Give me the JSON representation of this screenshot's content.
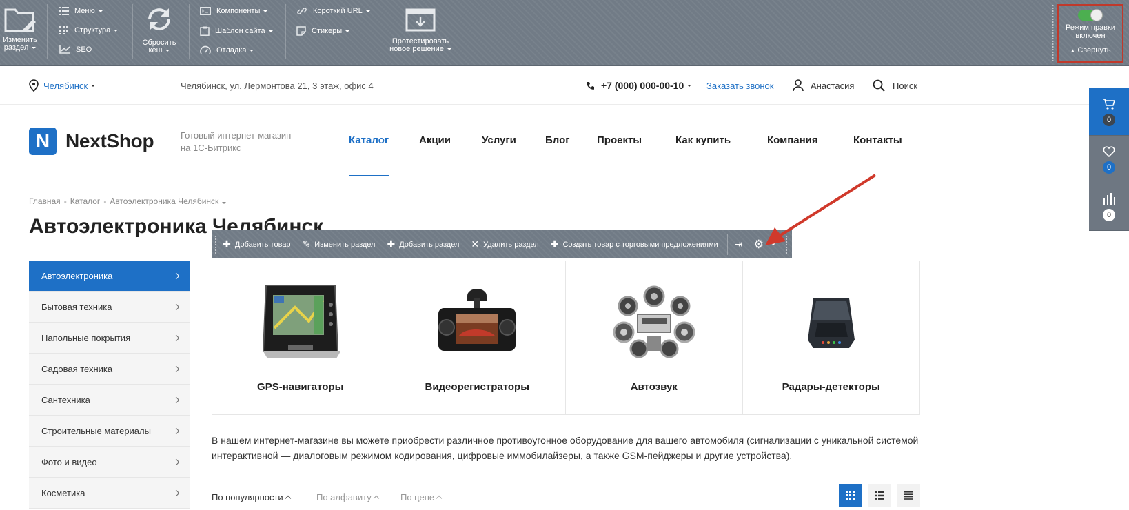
{
  "admin_panel": {
    "change_section": "Изменить раздел",
    "change_section_l1": "Изменить",
    "change_section_l2": "раздел",
    "menu": "Меню",
    "structure": "Структура",
    "seo": "SEO",
    "reset_cache_l1": "Сбросить",
    "reset_cache_l2": "кеш",
    "components": "Компоненты",
    "site_template": "Шаблон сайта",
    "debug": "Отладка",
    "short_url": "Короткий URL",
    "stickers": "Стикеры",
    "test_solution_l1": "Протестировать",
    "test_solution_l2": "новое решение",
    "edit_mode_l1": "Режим правки",
    "edit_mode_l2": "включен",
    "edit_mode_enabled": true,
    "collapse": "Свернуть"
  },
  "topline": {
    "city": "Челябинск",
    "address": "Челябинск, ул. Лермонтова 21, 3 этаж, офис 4",
    "phone": "+7 (000) 000-00-10",
    "callback": "Заказать звонок",
    "user": "Анастасия",
    "search": "Поиск"
  },
  "header": {
    "logo_text": "NextShop",
    "logo_mark": "N",
    "slogan_l1": "Готовый интернет-магазин",
    "slogan_l2": "на 1С-Битрикс",
    "nav": [
      "Каталог",
      "Акции",
      "Услуги",
      "Блог",
      "Проекты",
      "Как купить",
      "Компания",
      "Контакты"
    ],
    "nav_active": "Каталог"
  },
  "side_widget": {
    "cart_count": "0",
    "favorites_count": "0",
    "compare_count": "0"
  },
  "breadcrumbs": [
    "Главная",
    "Каталог",
    "Автоэлектроника Челябинск"
  ],
  "page_title": "Автоэлектроника Челябинск",
  "sidebar": {
    "items": [
      "Автоэлектроника",
      "Бытовая техника",
      "Напольные покрытия",
      "Садовая техника",
      "Сантехника",
      "Строительные материалы",
      "Фото и видео",
      "Косметика"
    ],
    "active": "Автоэлектроника"
  },
  "edit_toolbar": {
    "add_product": "Добавить товар",
    "edit_section": "Изменить раздел",
    "add_section": "Добавить раздел",
    "delete_section": "Удалить раздел",
    "create_offer": "Создать товар с торговыми предложениями"
  },
  "catalog": {
    "sections": [
      "GPS-навигаторы",
      "Видеорегистраторы",
      "Автозвук",
      "Радары-детекторы"
    ]
  },
  "description": "В нашем интернет-магазине вы можете приобрести различное противоугонное оборудование для вашего автомобиля (сигнализации с уникальной системой интерактивной — диалоговым режимом кодирования, цифровые иммобилайзеры, а также GSM-пейджеры и другие устройства).",
  "sorting": {
    "popularity": "По популярности",
    "alphabet": "По алфавиту",
    "price": "По цене"
  },
  "colors": {
    "accent": "#1e70c6",
    "admin_bg": "#717b86",
    "highlight": "#c0392b"
  }
}
